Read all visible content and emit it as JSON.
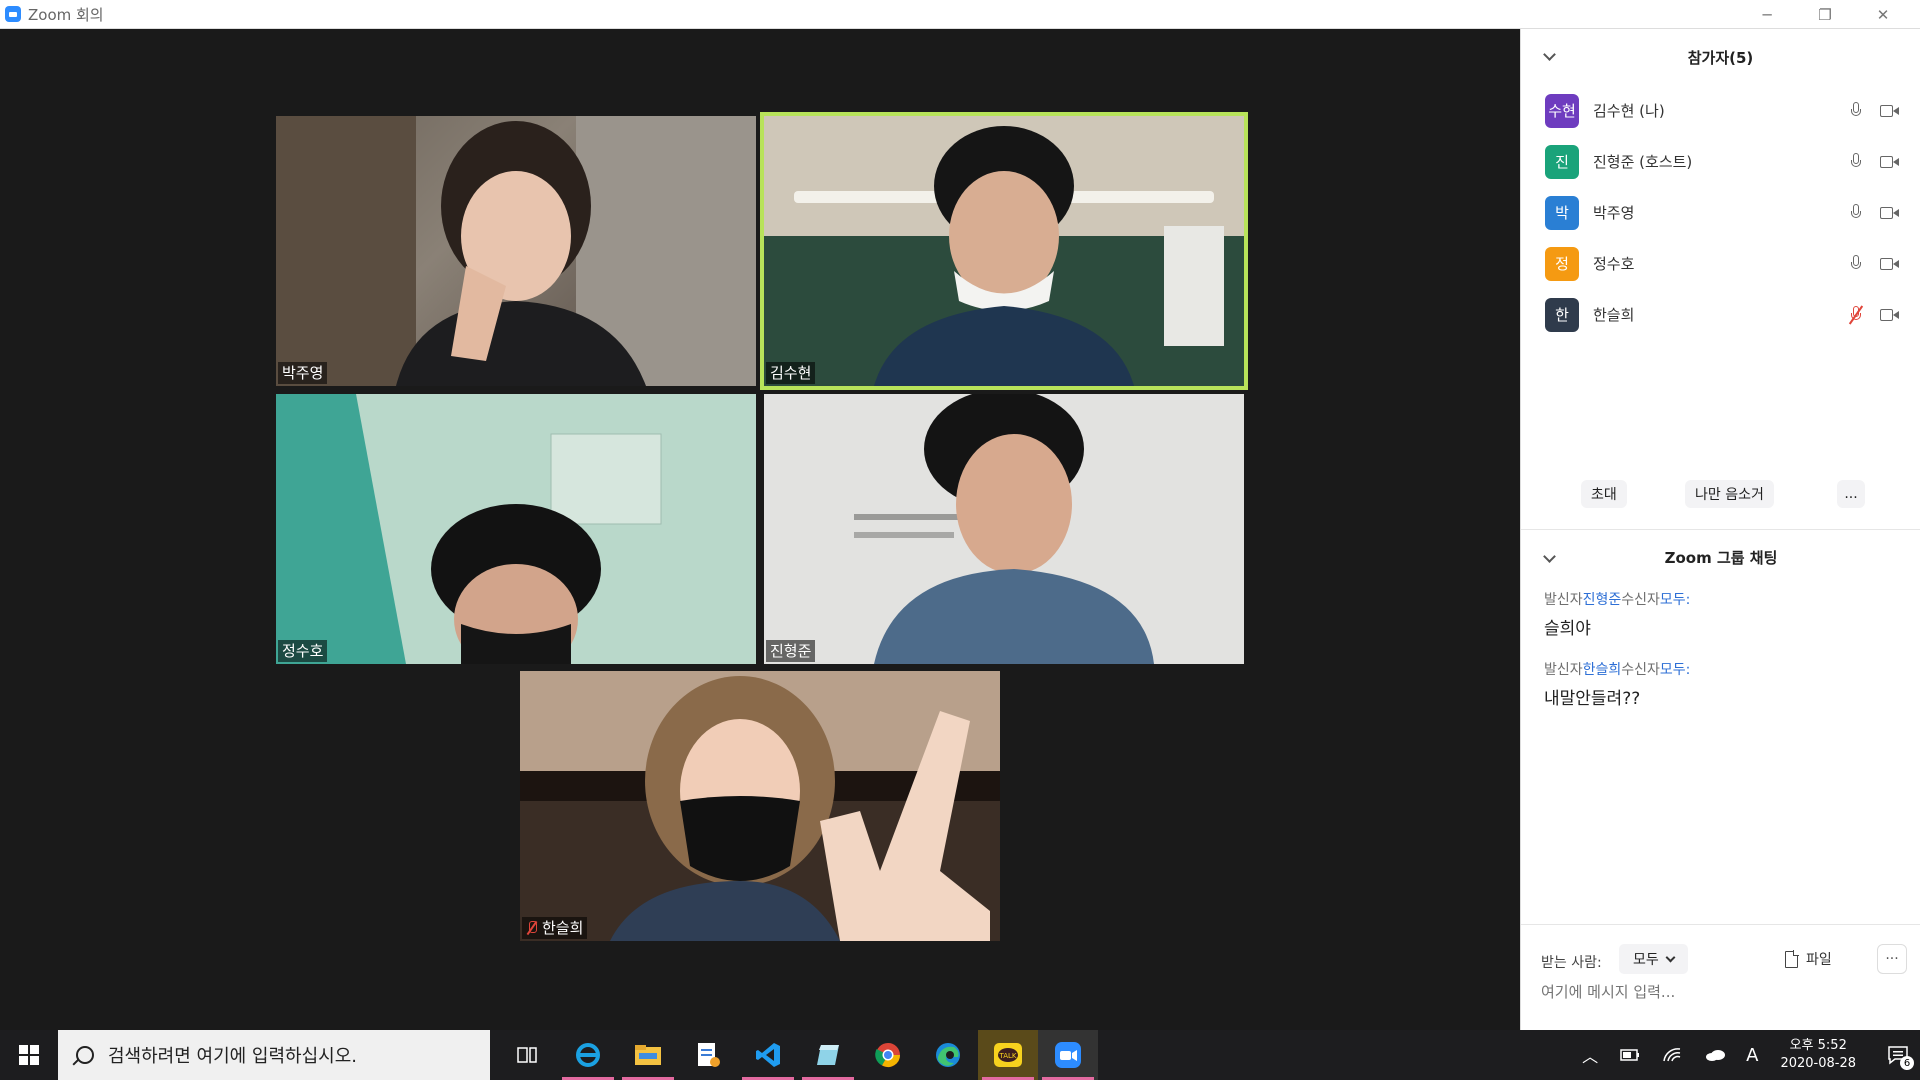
{
  "window": {
    "title": "Zoom 회의"
  },
  "video_tiles": [
    {
      "name": "박주영",
      "muted": false,
      "active": false
    },
    {
      "name": "김수현",
      "muted": false,
      "active": true
    },
    {
      "name": "정수호",
      "muted": false,
      "active": false
    },
    {
      "name": "진형준",
      "muted": false,
      "active": false
    },
    {
      "name": "한슬희",
      "muted": true,
      "active": false
    }
  ],
  "participants": {
    "header": "참가자(5)",
    "list": [
      {
        "avatar": "수현",
        "name": "김수현 (나)",
        "color": "#6e3cbf",
        "muted": false
      },
      {
        "avatar": "진",
        "name": "진형준 (호스트)",
        "color": "#1aa37a",
        "muted": false
      },
      {
        "avatar": "박",
        "name": "박주영",
        "color": "#2a7fd4",
        "muted": false
      },
      {
        "avatar": "정",
        "name": "정수호",
        "color": "#f59a12",
        "muted": false
      },
      {
        "avatar": "한",
        "name": "한슬희",
        "color": "#2f3b4c",
        "muted": true
      }
    ],
    "buttons": {
      "invite": "초대",
      "mute_me": "나만 음소거",
      "more": "..."
    }
  },
  "chat": {
    "header": "Zoom 그룹 채팅",
    "messages": [
      {
        "from_label": "발신자",
        "from": "진형준",
        "to_label": "수신자",
        "to": "모두:",
        "text": "슬희야"
      },
      {
        "from_label": "발신자",
        "from": "한슬희",
        "to_label": "수신자",
        "to": "모두:",
        "text": "내말안들려??"
      }
    ],
    "recipient_label": "받는 사람:",
    "recipient_value": "모두",
    "file_label": "파일",
    "more_label": "···",
    "input_placeholder": "여기에 메시지 입력..."
  },
  "taskbar": {
    "search_placeholder": "검색하려면 여기에 입력하십시오.",
    "time": "오후 5:52",
    "date": "2020-08-28",
    "ime": "A",
    "notifications": "6"
  }
}
